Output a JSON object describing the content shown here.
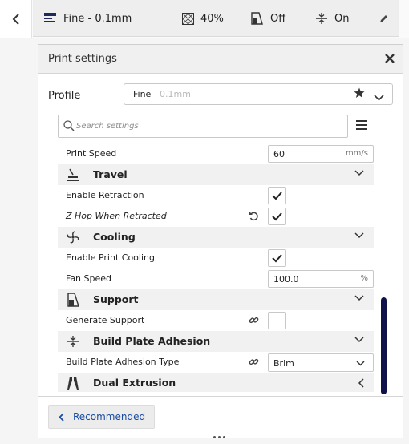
{
  "topbar": {
    "profile_summary": "Fine - 0.1mm",
    "infill": "40%",
    "support": "Off",
    "adhesion": "On"
  },
  "panel": {
    "title": "Print settings",
    "profile_label": "Profile",
    "profile_name": "Fine",
    "profile_detail": "0.1mm",
    "search_placeholder": "Search settings",
    "recommended_label": "Recommended"
  },
  "settings": {
    "print_speed": {
      "label": "Print Speed",
      "value": "60",
      "unit": "mm/s"
    },
    "travel": {
      "label": "Travel"
    },
    "enable_retraction": {
      "label": "Enable Retraction",
      "checked": true
    },
    "z_hop": {
      "label": "Z Hop When Retracted",
      "checked": true
    },
    "cooling": {
      "label": "Cooling"
    },
    "enable_print_cooling": {
      "label": "Enable Print Cooling",
      "checked": true
    },
    "fan_speed": {
      "label": "Fan Speed",
      "value": "100.0",
      "unit": "%"
    },
    "support": {
      "label": "Support"
    },
    "generate_support": {
      "label": "Generate Support",
      "checked": false
    },
    "build_plate_adhesion": {
      "label": "Build Plate Adhesion"
    },
    "adhesion_type": {
      "label": "Build Plate Adhesion Type",
      "value": "Brim"
    },
    "dual_extrusion": {
      "label": "Dual Extrusion"
    }
  },
  "colors": {
    "accent": "#1a4ca1",
    "scrollbar": "#10134b"
  }
}
